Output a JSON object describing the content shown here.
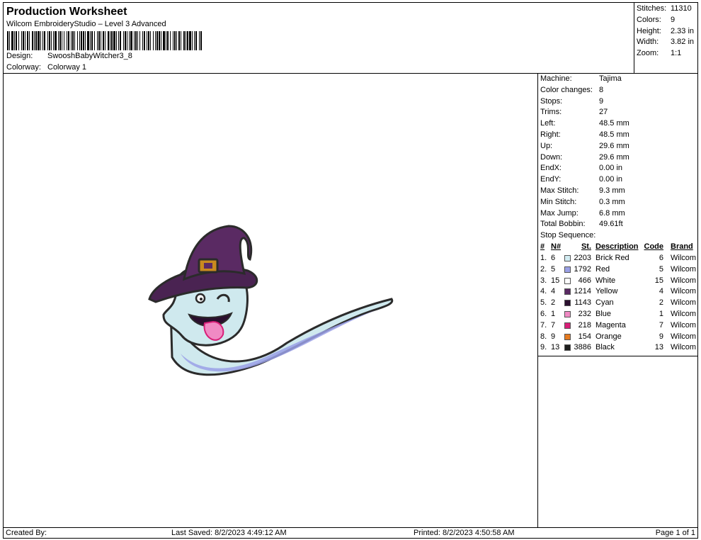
{
  "header": {
    "title": "Production Worksheet",
    "software": "Wilcom EmbroideryStudio – Level 3 Advanced",
    "design_label": "Design:",
    "design_value": "SwooshBabyWitcher3_8",
    "colorway_label": "Colorway:",
    "colorway_value": "Colorway 1"
  },
  "stats": {
    "stitches_label": "Stitches:",
    "stitches_value": "11310",
    "colors_label": "Colors:",
    "colors_value": "9",
    "height_label": "Height:",
    "height_value": "2.33 in",
    "width_label": "Width:",
    "width_value": "3.82 in",
    "zoom_label": "Zoom:",
    "zoom_value": "1:1"
  },
  "machine_info": [
    {
      "label": "Machine:",
      "value": "Tajima"
    },
    {
      "label": "Color changes:",
      "value": "8"
    },
    {
      "label": "Stops:",
      "value": "9"
    },
    {
      "label": "Trims:",
      "value": "27"
    },
    {
      "label": "Left:",
      "value": "48.5 mm"
    },
    {
      "label": "Right:",
      "value": "48.5 mm"
    },
    {
      "label": "Up:",
      "value": "29.6 mm"
    },
    {
      "label": "Down:",
      "value": "29.6 mm"
    },
    {
      "label": "EndX:",
      "value": "0.00 in"
    },
    {
      "label": "EndY:",
      "value": "0.00 in"
    },
    {
      "label": "Max Stitch:",
      "value": "9.3 mm"
    },
    {
      "label": "Min Stitch:",
      "value": "0.3 mm"
    },
    {
      "label": "Max Jump:",
      "value": "6.8 mm"
    },
    {
      "label": "Total Bobbin:",
      "value": "49.61ft"
    }
  ],
  "stop_sequence": {
    "label": "Stop Sequence:",
    "headers": {
      "idx": "#",
      "n": "N#",
      "st": "St.",
      "desc": "Description",
      "code": "Code",
      "brand": "Brand"
    },
    "rows": [
      {
        "idx": "1.",
        "n": "6",
        "color": "#d2ecf2",
        "st": "2203",
        "desc": "Brick Red",
        "code": "6",
        "brand": "Wilcom"
      },
      {
        "idx": "2.",
        "n": "5",
        "color": "#9aa0e6",
        "st": "1792",
        "desc": "Red",
        "code": "5",
        "brand": "Wilcom"
      },
      {
        "idx": "3.",
        "n": "15",
        "color": "#ffffff",
        "st": "466",
        "desc": "White",
        "code": "15",
        "brand": "Wilcom"
      },
      {
        "idx": "4.",
        "n": "4",
        "color": "#5a2a63",
        "st": "1214",
        "desc": "Yellow",
        "code": "4",
        "brand": "Wilcom"
      },
      {
        "idx": "5.",
        "n": "2",
        "color": "#2a0f2e",
        "st": "1143",
        "desc": "Cyan",
        "code": "2",
        "brand": "Wilcom"
      },
      {
        "idx": "6.",
        "n": "1",
        "color": "#f08ac4",
        "st": "232",
        "desc": "Blue",
        "code": "1",
        "brand": "Wilcom"
      },
      {
        "idx": "7.",
        "n": "7",
        "color": "#d81f78",
        "st": "218",
        "desc": "Magenta",
        "code": "7",
        "brand": "Wilcom"
      },
      {
        "idx": "8.",
        "n": "9",
        "color": "#e57a1f",
        "st": "154",
        "desc": "Orange",
        "code": "9",
        "brand": "Wilcom"
      },
      {
        "idx": "9.",
        "n": "13",
        "color": "#1e1e1e",
        "st": "3886",
        "desc": "Black",
        "code": "13",
        "brand": "Wilcom"
      }
    ]
  },
  "footer": {
    "created_by": "Created By:",
    "last_saved": "Last Saved: 8/2/2023 4:49:12 AM",
    "printed": "Printed: 8/2/2023 4:50:58 AM",
    "page": "Page 1 of 1"
  }
}
